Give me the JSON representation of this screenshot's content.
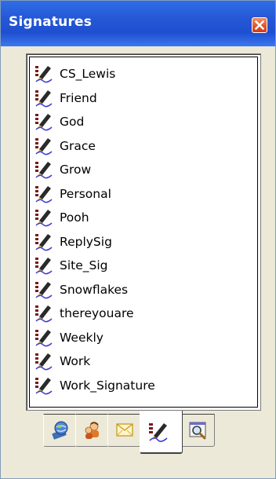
{
  "window": {
    "title": "Signatures"
  },
  "icons": {
    "close": "close-icon",
    "signature_item": "signature-pen-icon",
    "tabs": [
      "preview-globe-icon",
      "people-icon",
      "stationery-envelope-icon",
      "signature-pen-icon",
      "browse-magnifier-icon"
    ]
  },
  "signatures": {
    "items": [
      {
        "label": "CS_Lewis"
      },
      {
        "label": "Friend"
      },
      {
        "label": "God"
      },
      {
        "label": "Grace"
      },
      {
        "label": "Grow"
      },
      {
        "label": "Personal"
      },
      {
        "label": "Pooh"
      },
      {
        "label": "ReplySig"
      },
      {
        "label": "Site_Sig"
      },
      {
        "label": "Snowflakes"
      },
      {
        "label": "thereyouare"
      },
      {
        "label": "Weekly"
      },
      {
        "label": "Work"
      },
      {
        "label": "Work_Signature"
      }
    ]
  },
  "tabs": {
    "active_index": 3
  },
  "colors": {
    "titlebar": "#2557d5",
    "close_button": "#e3572e",
    "window_bg": "#ece9d8"
  }
}
